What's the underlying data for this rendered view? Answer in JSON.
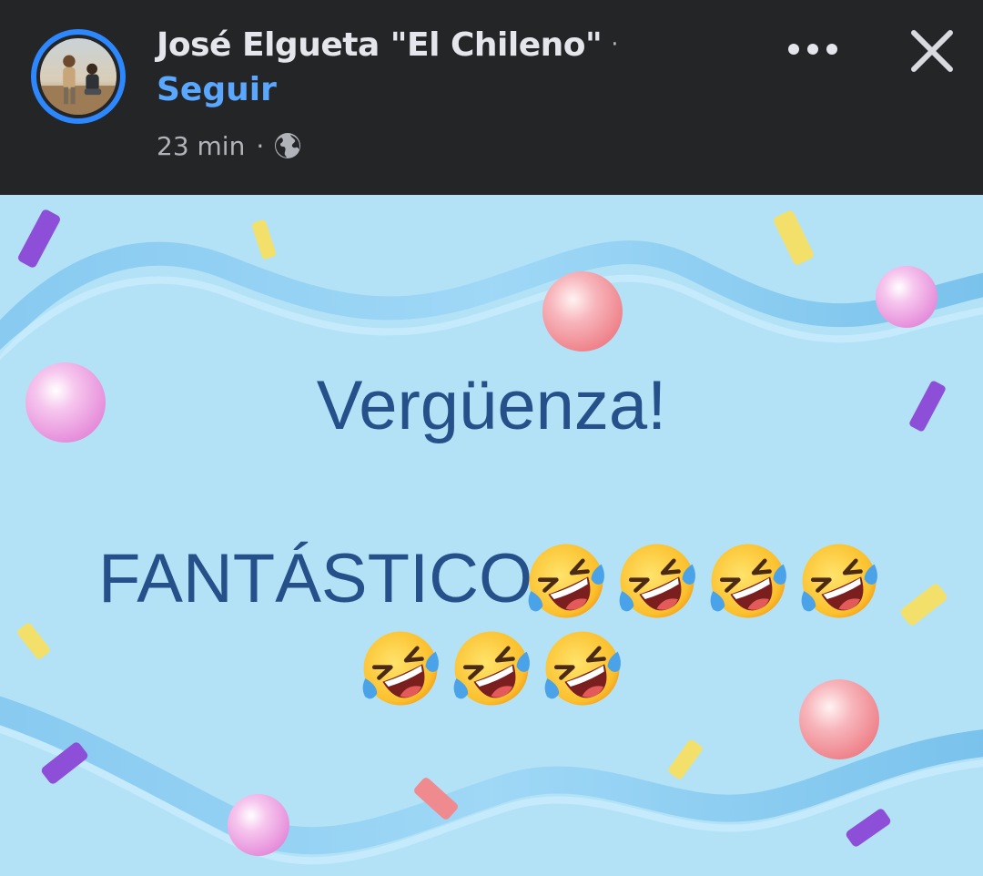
{
  "header": {
    "author_name": "José Elgueta \"El Chileno\"",
    "separator_dot": "·",
    "follow_label": "Seguir",
    "time": "23 min",
    "meta_dot": "·",
    "audience_icon": "globe-icon",
    "more_icon": "more-options-icon",
    "close_icon": "close-icon"
  },
  "post": {
    "text_line1": "Vergüenza!",
    "text_line2": "FANTÁSTICO",
    "emoji": "rolling-on-floor-laughing",
    "emoji_count": 7,
    "background": "#b3e2f7",
    "text_color": "#26508a"
  },
  "colors": {
    "header_bg": "#242526",
    "name": "#e4e6eb",
    "follow": "#5aa7ff",
    "meta": "#b0b3b8",
    "avatar_ring": "#2d88ff"
  }
}
